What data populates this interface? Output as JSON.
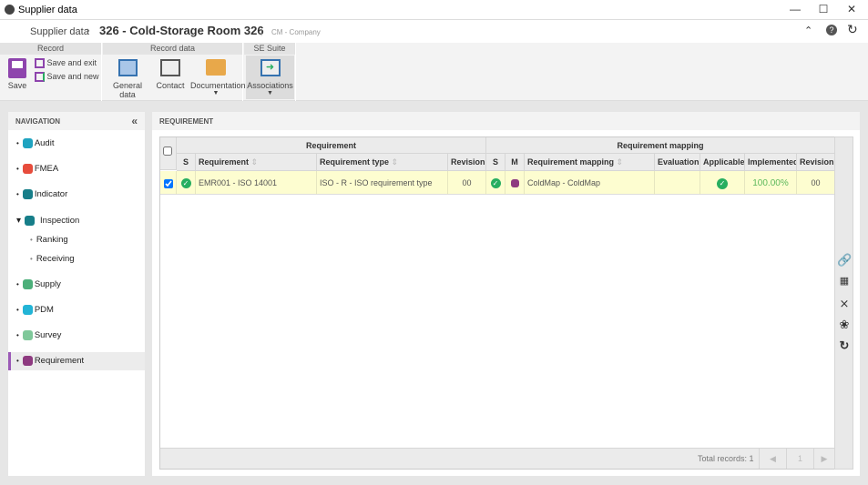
{
  "window": {
    "title": "Supplier data"
  },
  "header": {
    "breadcrumb": "Supplier data",
    "record_title": "326 - Cold-Storage Room 326",
    "company": "CM - Company"
  },
  "ribbon": {
    "groups": [
      {
        "label": "Record"
      },
      {
        "label": "Record data"
      },
      {
        "label": "SE Suite"
      }
    ],
    "save": "Save",
    "save_exit": "Save and exit",
    "save_new": "Save and new",
    "general_data": "General data",
    "contact": "Contact",
    "documentation": "Documentation",
    "associations": "Associations"
  },
  "navigation": {
    "title": "NAVIGATION",
    "items": [
      {
        "label": "Audit",
        "color": "#1fa3c0"
      },
      {
        "label": "FMEA",
        "color": "#e74c3c"
      },
      {
        "label": "Indicator",
        "color": "#177e89"
      },
      {
        "label": "Inspection",
        "color": "#177e89"
      },
      {
        "label": "Ranking"
      },
      {
        "label": "Receiving"
      },
      {
        "label": "Supply",
        "color": "#4caf7a"
      },
      {
        "label": "PDM",
        "color": "#22b4d6"
      },
      {
        "label": "Survey",
        "color": "#7fc89a"
      },
      {
        "label": "Requirement",
        "color": "#8e3a80"
      }
    ]
  },
  "main": {
    "title": "REQUIREMENT",
    "grid": {
      "group_headers": [
        "Requirement",
        "Requirement mapping"
      ],
      "columns": [
        "S",
        "Requirement",
        "Requirement type",
        "Revision",
        "S",
        "M",
        "Requirement mapping",
        "Evaluation",
        "Applicable",
        "Implemented",
        "Revision"
      ],
      "rows": [
        {
          "checked": true,
          "requirement": "EMR001 - ISO 14001",
          "requirement_type": "ISO - R - ISO requirement type",
          "revision": "00",
          "mapping": "ColdMap - ColdMap",
          "evaluation": "",
          "applicable": true,
          "implemented": "100.00%",
          "mapping_revision": "00"
        }
      ],
      "footer": {
        "total": "Total records: 1",
        "page": "1"
      }
    }
  },
  "colors": {
    "accent": "#9b59b6",
    "row_highlight": "#fdfdd0",
    "success": "#27ae60"
  }
}
